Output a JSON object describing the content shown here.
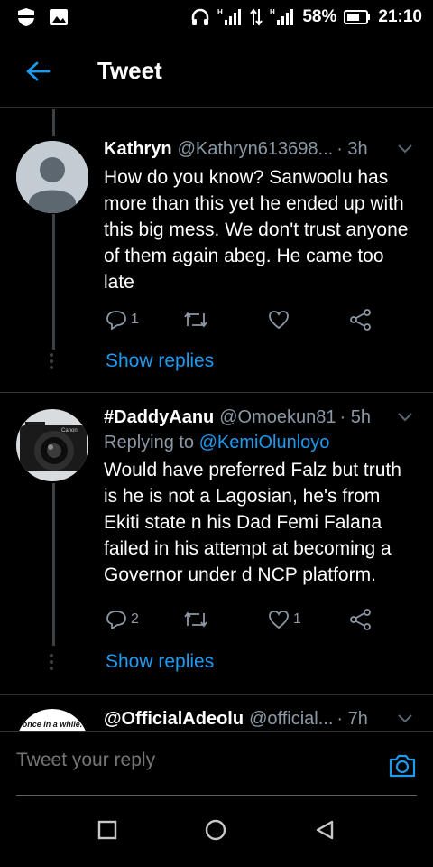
{
  "status_bar": {
    "battery_percent": "58%",
    "time": "21:10"
  },
  "header": {
    "title": "Tweet"
  },
  "tweets": [
    {
      "name": "Kathryn",
      "handle": "@Kathryn613698...",
      "time": "· 3h",
      "replying_to": "",
      "text": "How do you know? Sanwoolu has more than this yet he ended up with this big mess. We don't trust anyone of them again abeg. He came too late",
      "reply_count": "1",
      "like_count": "",
      "show_replies": "Show replies"
    },
    {
      "name": "#DaddyAanu",
      "handle": "@Omoekun81",
      "time": "· 5h",
      "replying_prefix": "Replying to ",
      "replying_to": "@KemiOlunloyo",
      "text": "Would have preferred Falz but truth is he is not a Lagosian, he's from Ekiti state n his Dad Femi Falana failed in his attempt at becoming a Governor under d NCP platform.",
      "reply_count": "2",
      "like_count": "1",
      "show_replies": "Show replies"
    },
    {
      "name": "@OfficialAdeolu",
      "handle": "@official...",
      "time": "· 7h",
      "avatar_text": "once in a while."
    }
  ],
  "reply_bar": {
    "placeholder": "Tweet your reply"
  },
  "colors": {
    "accent": "#1d9bf0",
    "muted": "#8b98a5",
    "background": "#000000"
  }
}
